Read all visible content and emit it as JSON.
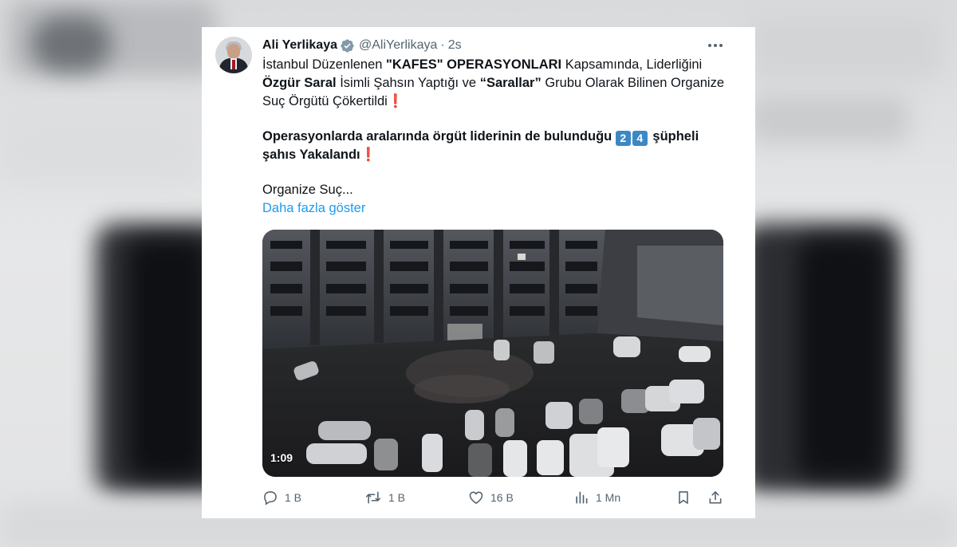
{
  "tweet": {
    "author_name": "Ali Yerlikaya",
    "handle": "@AliYerlikaya",
    "separator": "·",
    "time": "2s",
    "paragraph1": {
      "t1": "İstanbul Düzenlenen ",
      "b1": "\"KAFES\" OPERASYONLARI",
      "t2": " Kapsamında, Liderliğini ",
      "b2": "Özgür Saral",
      "t3": " İsimli Şahsın Yaptığı ve ",
      "b3": "“Sarallar”",
      "t4": " Grubu Olarak Bilinen Organize Suç Örgütü Çökertildi",
      "mark": "❗"
    },
    "paragraph2": {
      "b1": "Operasyonlarda aralarında örgüt liderinin de bulunduğu ",
      "digit1": "2",
      "digit2": "4",
      "b2": " şüpheli şahıs Yakalandı",
      "mark": "❗"
    },
    "paragraph3": "Organize Suç...",
    "show_more": "Daha fazla göster",
    "video": {
      "duration": "1:09"
    },
    "actions": {
      "replies": "1 B",
      "reposts": "1 B",
      "likes": "16 B",
      "views": "1 Mn"
    }
  },
  "icons": {
    "verified": "verified-badge-icon",
    "more": "more-dots-icon",
    "reply": "reply-icon",
    "repost": "repost-icon",
    "like": "heart-icon",
    "views": "views-chart-icon",
    "bookmark": "bookmark-icon",
    "share": "share-icon"
  },
  "colors": {
    "link": "#1d9bf0",
    "secondary_text": "#536471",
    "primary_text": "#0f1419",
    "verified_badge": "#829aab",
    "exclamation": "#e0245e",
    "keycap": "#3b88c3"
  }
}
